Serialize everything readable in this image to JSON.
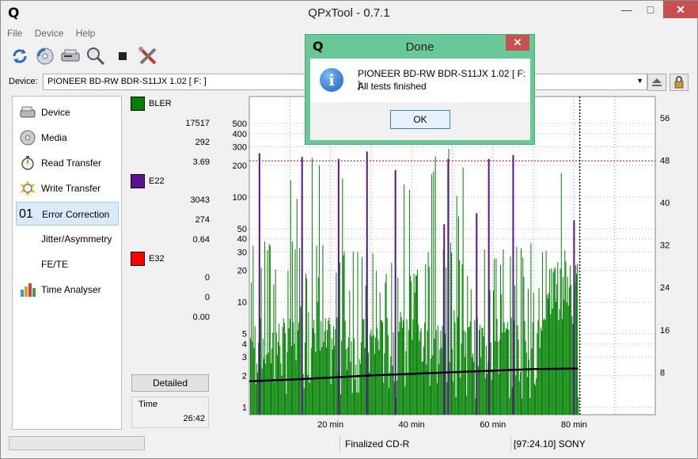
{
  "window": {
    "title": "QPxTool - 0.7.1",
    "logo_letter": "Q",
    "minimize_glyph": "—",
    "maximize_glyph": "□",
    "close_glyph": "✕"
  },
  "menu": [
    "File",
    "Device",
    "Help"
  ],
  "toolbar": [
    "refresh-icon",
    "device-info-icon",
    "scan-drive-icon",
    "search-media-icon",
    "stop-icon",
    "preferences-tools-icon"
  ],
  "device": {
    "label": "Device:",
    "selected": "PIONEER  BD-RW  BDR-S11JX 1.02 [ F: ]"
  },
  "nav": [
    {
      "label": "Device",
      "icon": "drive-icon"
    },
    {
      "label": "Media",
      "icon": "disc-icon"
    },
    {
      "label": "Read Transfer",
      "icon": "stopwatch-icon"
    },
    {
      "label": "Write Transfer",
      "icon": "burst-stopwatch-icon"
    },
    {
      "label": "Error Correction",
      "icon": "01",
      "active": true
    },
    {
      "label": "Jitter/Asymmetry",
      "icon": ""
    },
    {
      "label": "FE/TE",
      "icon": ""
    },
    {
      "label": "Time Analyser",
      "icon": "bars-icon"
    }
  ],
  "stats": {
    "bler": {
      "name": "BLER",
      "color": "#008000",
      "total": "17517",
      "max": "292",
      "avg": "3.69"
    },
    "e22": {
      "name": "E22",
      "color": "#5a1390",
      "total": "3043",
      "max": "274",
      "avg": "0.64"
    },
    "e32": {
      "name": "E32",
      "color": "#ff0000",
      "total": "0",
      "max": "0",
      "avg": "0.00"
    },
    "detailed_label": "Detailed",
    "time_label": "Time",
    "time_value": "26:42"
  },
  "chart_data": {
    "type": "line",
    "x_unit": "min",
    "x_ticks": [
      "20 min",
      "40 min",
      "60 min",
      "80 min"
    ],
    "x_tick_values": [
      20,
      40,
      60,
      80
    ],
    "xlim": [
      0,
      100
    ],
    "y_scale": "log",
    "y_ticks": [
      1,
      2,
      3,
      4,
      5,
      10,
      20,
      30,
      40,
      50,
      100,
      200,
      300,
      400,
      500
    ],
    "ylim": [
      0.85,
      900
    ],
    "y2_ticks": [
      8,
      16,
      24,
      32,
      40,
      48,
      56
    ],
    "y2lim": [
      0,
      60
    ],
    "grid": true,
    "red_threshold": 220,
    "disc_end_min": 81.4,
    "series": [
      {
        "name": "BLER",
        "color": "#008000",
        "style": "dense-errors",
        "peak": 292
      },
      {
        "name": "E22",
        "color": "#5a1390",
        "style": "spikes",
        "points": [
          [
            2.5,
            260
          ],
          [
            13,
            240
          ],
          [
            22,
            230
          ],
          [
            29,
            270
          ],
          [
            36,
            180
          ],
          [
            48,
            55
          ],
          [
            49,
            230
          ],
          [
            56,
            70
          ],
          [
            59,
            230
          ],
          [
            65,
            250
          ],
          [
            80,
            60
          ]
        ]
      },
      {
        "name": "Speed",
        "color": "#000000",
        "axis": "right",
        "points": [
          [
            0,
            6.3
          ],
          [
            10,
            6.6
          ],
          [
            20,
            7.0
          ],
          [
            30,
            7.4
          ],
          [
            40,
            7.7
          ],
          [
            50,
            8.0
          ],
          [
            60,
            8.3
          ],
          [
            70,
            8.6
          ],
          [
            80,
            8.7
          ],
          [
            81,
            8.7
          ]
        ]
      }
    ]
  },
  "statusbar": {
    "media": "Finalized CD-R",
    "mid": "[97:24.10] SONY"
  },
  "dialog": {
    "title": "Done",
    "logo_letter": "Q",
    "close_glyph": "✕",
    "info_glyph": "i",
    "line1": "PIONEER  BD-RW  BDR-S11JX 1.02 [ F: ]:",
    "line2": "All tests finished",
    "ok_label": "OK"
  }
}
